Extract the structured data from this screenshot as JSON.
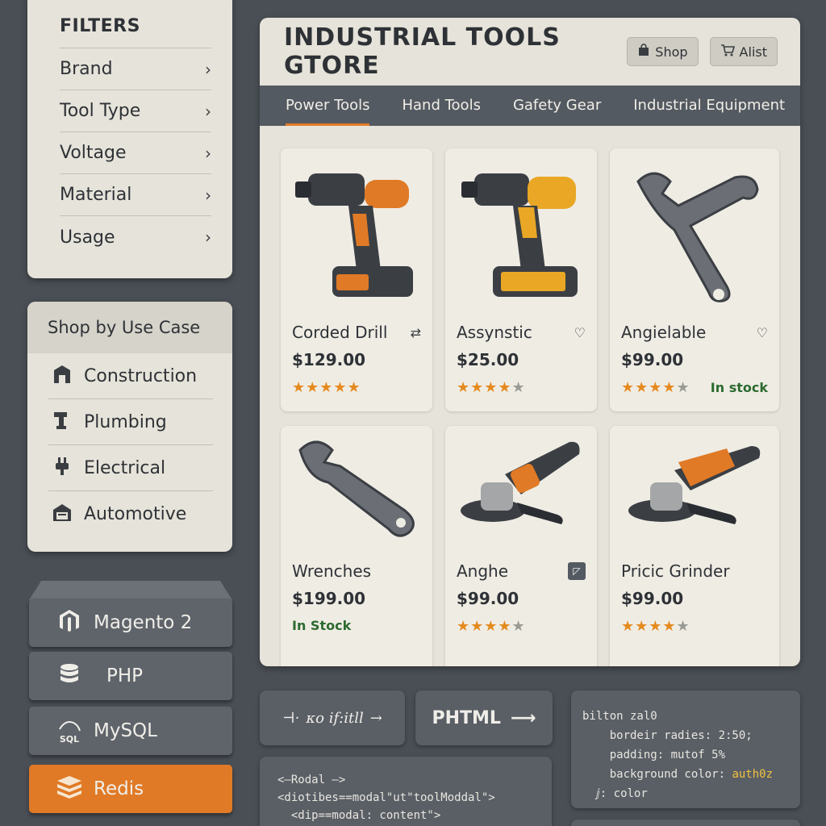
{
  "filters": {
    "title": "FILTERS",
    "items": [
      {
        "label": "Brand"
      },
      {
        "label": "Tool Type"
      },
      {
        "label": "Voltage"
      },
      {
        "label": "Material"
      },
      {
        "label": "Usage"
      }
    ]
  },
  "use_case": {
    "title": "Shop by Use Case",
    "items": [
      {
        "label": "Construction",
        "icon": "building-icon"
      },
      {
        "label": "Plumbing",
        "icon": "pipe-icon"
      },
      {
        "label": "Electrical",
        "icon": "plug-icon"
      },
      {
        "label": "Automotive",
        "icon": "garage-icon"
      }
    ]
  },
  "stack": {
    "magento": "Magento 2",
    "php": "PHP",
    "mysql": "MySQL",
    "mysql_icon_text": "SQL",
    "redis": "Redis"
  },
  "store": {
    "title": "INDUSTRIAL TOOLS GTORE",
    "shop_button": "Shop",
    "alist_button": "Alist",
    "tabs": [
      "Power Tools",
      "Hand Tools",
      "Gafety Gear",
      "Industrial Equipment"
    ],
    "products": [
      {
        "name": "Corded Drill",
        "price": "$129.00",
        "rating": 5,
        "stock": "",
        "image": "drill-orange"
      },
      {
        "name": "Assynstic",
        "price": "$25.00",
        "rating": 4,
        "stock": "",
        "image": "drill-yellow"
      },
      {
        "name": "Angielable",
        "price": "$99.00",
        "rating": 4,
        "stock": "In stock",
        "image": "wrench-large"
      },
      {
        "name": "Wrenches",
        "price": "$199.00",
        "rating": 0,
        "stock": "In Stock",
        "image": "wrench"
      },
      {
        "name": "Anghe",
        "price": "$99.00",
        "rating": 4,
        "stock": "",
        "image": "grinder-grey"
      },
      {
        "name": "Pricic Grinder",
        "price": "$99.00",
        "rating": 4,
        "stock": "",
        "image": "grinder-orange"
      }
    ]
  },
  "code": {
    "modal_button": "κo if:itll",
    "phtml_button": "PHTML",
    "snippet": "<—Rodal —>\n<diotibes==modal\"ut\"toolModdal\">\n  <dip==modal: content\">",
    "css_selector": "biltоn zal0",
    "css_line1": "bordeir radies: 2:50;",
    "css_line2": "padding: mutof 5%",
    "css_line3_key": "background color: ",
    "css_line3_val": "auth0z",
    "css_line4": "color"
  },
  "colors": {
    "accent": "#e07a26",
    "background": "#4a4f55",
    "panel": "#e6e3da",
    "in_stock": "#2c6b2f"
  }
}
